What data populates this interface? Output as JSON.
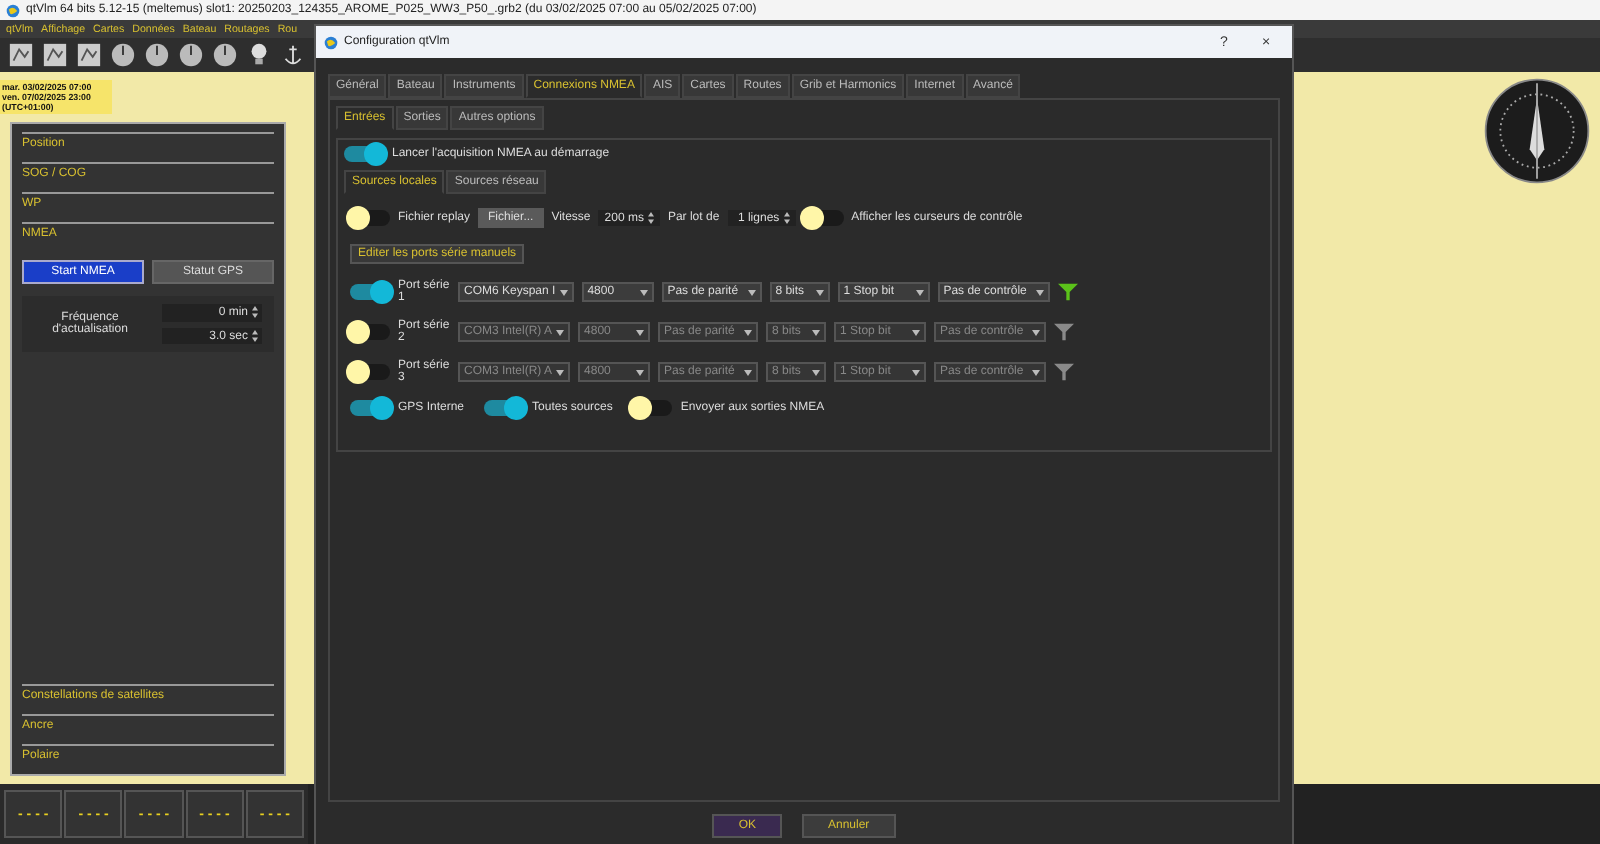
{
  "main_window": {
    "title": "qtVlm 64 bits 5.12-15 (meltemus) slot1: 20250203_124355_AROME_P025_WW3_P50_.grb2 (du 03/02/2025 07:00 au 05/02/2025 07:00)",
    "menu": [
      "qtVlm",
      "Affichage",
      "Cartes",
      "Données",
      "Bateau",
      "Routages",
      "Rou"
    ]
  },
  "grib_info": [
    "mar. 03/02/2025 07:00",
    "ven. 07/02/2025 23:00",
    "(UTC+01:00)"
  ],
  "left_panel": {
    "top_sections": [
      "Position",
      "SOG / COG",
      "WP",
      "NMEA"
    ],
    "buttons": [
      {
        "label": "Start NMEA",
        "selected": true
      },
      {
        "label": "Statut GPS",
        "selected": false
      }
    ],
    "frequency": {
      "label": "Fréquence d'actualisation",
      "values": [
        "0 min",
        "3.0 sec"
      ]
    },
    "bottom_sections": [
      "Constellations de satellites",
      "Ancre",
      "Polaire"
    ]
  },
  "instrument_bar": [
    "- - - -",
    "- - - -",
    "- - - -",
    "- - - -",
    "- - - -"
  ],
  "dialog": {
    "title": "Configuration qtVlm",
    "help": "?",
    "close": "×",
    "tabs": [
      {
        "label": "Général",
        "selected": false
      },
      {
        "label": "Bateau",
        "selected": false
      },
      {
        "label": "Instruments",
        "selected": false
      },
      {
        "label": "Connexions NMEA",
        "selected": true
      },
      {
        "label": "AIS",
        "selected": false
      },
      {
        "label": "Cartes",
        "selected": false
      },
      {
        "label": "Routes",
        "selected": false
      },
      {
        "label": "Grib et Harmonics",
        "selected": false
      },
      {
        "label": "Internet",
        "selected": false
      },
      {
        "label": "Avancé",
        "selected": false
      }
    ],
    "subtabs": [
      {
        "label": "Entrées",
        "selected": true
      },
      {
        "label": "Sorties",
        "selected": false
      },
      {
        "label": "Autres options",
        "selected": false
      }
    ],
    "start_acquisition": {
      "label": "Lancer l'acquisition NMEA au démarrage",
      "on": true
    },
    "source_tabs": [
      {
        "label": "Sources locales",
        "selected": true
      },
      {
        "label": "Sources réseau",
        "selected": false
      }
    ],
    "replay": {
      "label": "Fichier replay",
      "on": false,
      "file_button": "Fichier...",
      "speed_label": "Vitesse",
      "speed": "200 ms",
      "batch_label": "Par lot de",
      "batch": "1 lignes"
    },
    "show_cursors": {
      "label": "Afficher les curseurs de contrôle",
      "on": false
    },
    "edit_ports_button": "Editer les ports série manuels",
    "ports": [
      {
        "label": "Port série 1",
        "on": true,
        "fields": [
          "COM6 Keyspan I",
          "4800",
          "Pas de parité",
          "8 bits",
          "1 Stop bit",
          "Pas de contrôle"
        ]
      },
      {
        "label": "Port série 2",
        "on": false,
        "fields": [
          "COM3 Intel(R) A",
          "4800",
          "Pas de parité",
          "8 bits",
          "1 Stop bit",
          "Pas de contrôle"
        ]
      },
      {
        "label": "Port série 3",
        "on": false,
        "fields": [
          "COM3 Intel(R) A",
          "4800",
          "Pas de parité",
          "8 bits",
          "1 Stop bit",
          "Pas de contrôle"
        ]
      }
    ],
    "bottom_toggles": [
      {
        "label": "GPS Interne",
        "on": true
      },
      {
        "label": "Toutes sources",
        "on": true
      },
      {
        "label": "Envoyer aux sorties NMEA",
        "on": false
      }
    ],
    "buttons": [
      "OK",
      "Annuler"
    ]
  }
}
